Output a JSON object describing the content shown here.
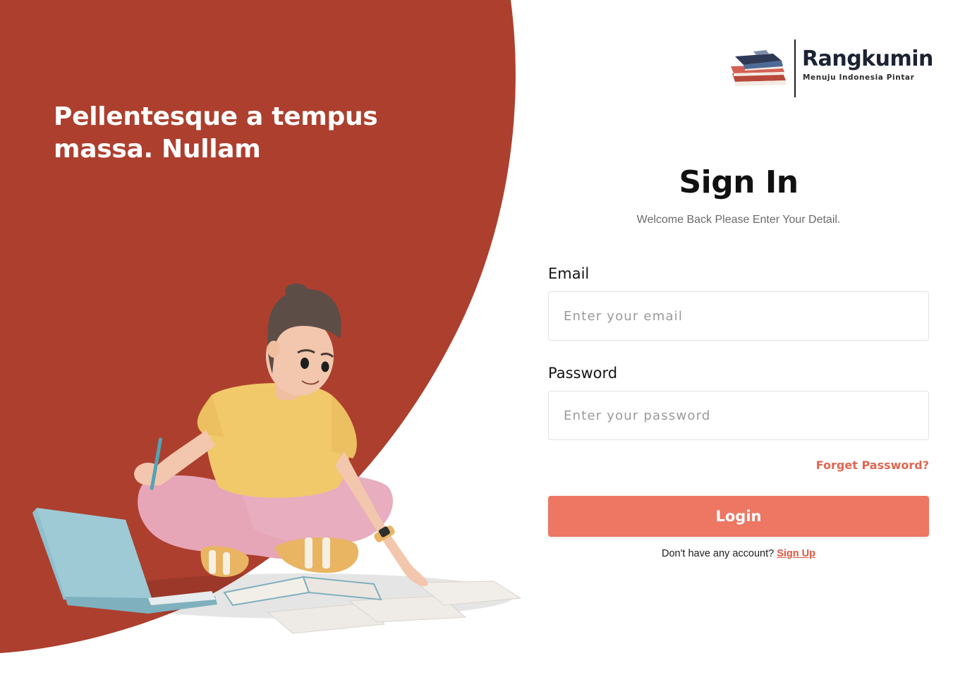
{
  "hero": {
    "headline": "Pellentesque a tempus massa. Nullam",
    "illustration": "student-studying-on-floor-with-laptop",
    "background_color": "#ad3f2e"
  },
  "brand": {
    "name": "Rangkumin",
    "tagline": "Menuju Indonesia Pintar",
    "logo_icon": "stacked-books-icon"
  },
  "form": {
    "title": "Sign In",
    "subtitle": "Welcome Back Please Enter Your Detail.",
    "email": {
      "label": "Email",
      "placeholder": "Enter your email",
      "value": ""
    },
    "password": {
      "label": "Password",
      "placeholder": "Enter your password",
      "value": ""
    },
    "forgot_label": "Forget Password?",
    "login_label": "Login",
    "signup_prompt": "Don't have any account?",
    "signup_label": "Sign Up"
  },
  "colors": {
    "accent": "#ed7763",
    "link": "#e0563f",
    "hero": "#ad3f2e"
  }
}
